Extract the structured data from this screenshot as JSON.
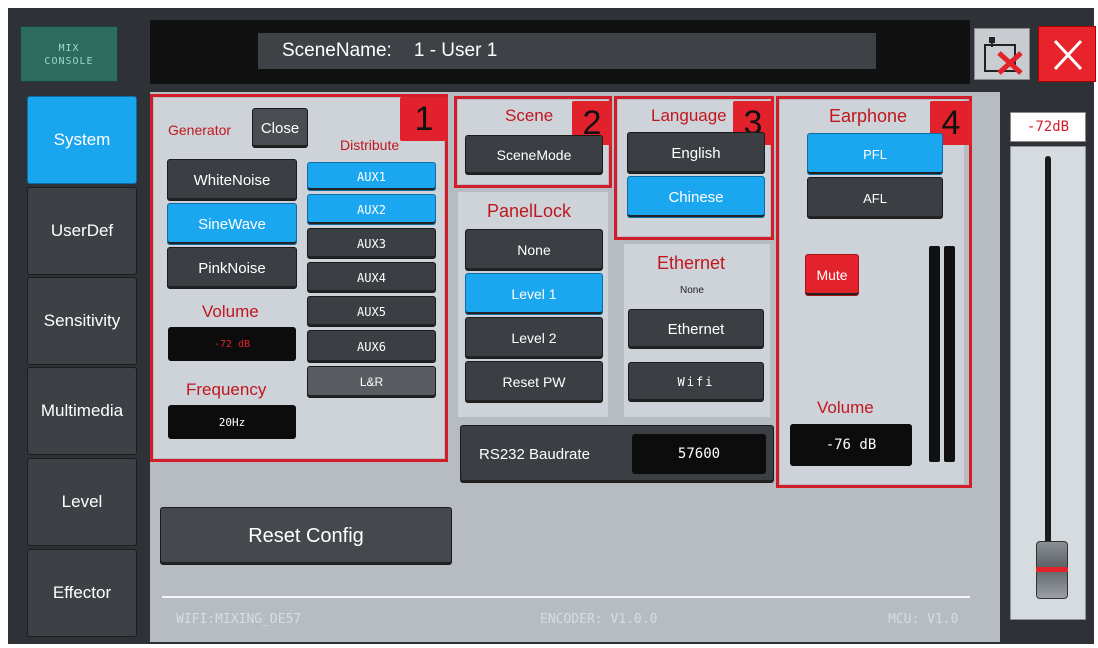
{
  "logo": {
    "line1": "MIX",
    "line2": "CONSOLE"
  },
  "sidebar": {
    "items": [
      {
        "label": "System"
      },
      {
        "label": "UserDef"
      },
      {
        "label": "Sensitivity"
      },
      {
        "label": "Multimedia"
      },
      {
        "label": "Level"
      },
      {
        "label": "Effector"
      }
    ]
  },
  "header": {
    "scene_label": "SceneName:",
    "scene_value": "1 - User 1"
  },
  "generator": {
    "badge": "1",
    "title": "Generator",
    "close_label": "Close",
    "buttons": [
      "WhiteNoise",
      "SineWave",
      "PinkNoise"
    ],
    "distribute_title": "Distribute",
    "distribute": [
      "AUX1",
      "AUX2",
      "AUX3",
      "AUX4",
      "AUX5",
      "AUX6",
      "L&R"
    ],
    "volume_title": "Volume",
    "volume_value": "-72 dB",
    "frequency_title": "Frequency",
    "frequency_value": "20Hz"
  },
  "scene": {
    "badge": "2",
    "title": "Scene",
    "button": "SceneMode"
  },
  "language": {
    "badge": "3",
    "title": "Language",
    "options": [
      "English",
      "Chinese"
    ]
  },
  "earphone": {
    "badge": "4",
    "title": "Earphone",
    "options": [
      "PFL",
      "AFL"
    ],
    "mute_label": "Mute",
    "volume_title": "Volume",
    "volume_value": "-76 dB"
  },
  "panellock": {
    "title": "PanelLock",
    "options": [
      "None",
      "Level 1",
      "Level 2",
      "Reset PW"
    ]
  },
  "ethernet": {
    "title": "Ethernet",
    "status": "None",
    "ethernet_button": "Ethernet",
    "wifi_button": "Wifi"
  },
  "rs232": {
    "label": "RS232 Baudrate",
    "value": "57600"
  },
  "reset": {
    "label": "Reset Config"
  },
  "fader": {
    "value_label": "-72dB"
  },
  "footer": {
    "wifi": "WIFI:MIXING_DE57",
    "encoder": "ENCODER: V1.0.0",
    "mcu": "MCU: V1.0"
  },
  "colors": {
    "accent": "#1aa6ee",
    "alert": "#e2232b",
    "panel": "#cdd3d9"
  }
}
